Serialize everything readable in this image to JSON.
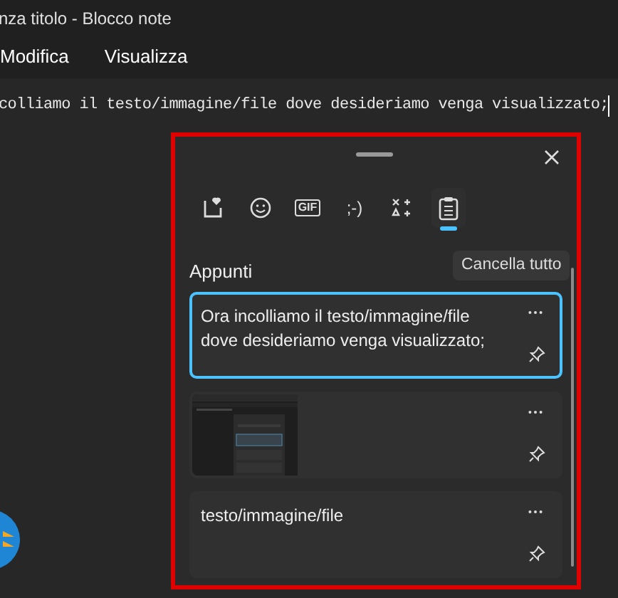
{
  "window": {
    "title": "nza titolo - Blocco note"
  },
  "menu": [
    "Modifica",
    "Visualizza"
  ],
  "editor": {
    "text": "colliamo il testo/immagine/file dove desideriamo venga visualizzato;"
  },
  "clipboard_panel": {
    "tabs": [
      {
        "kind": "favorites",
        "selected": false
      },
      {
        "kind": "emoji",
        "selected": false
      },
      {
        "kind": "gif",
        "label": "GIF",
        "selected": false
      },
      {
        "kind": "kaomoji",
        "label": ";-)",
        "selected": false
      },
      {
        "kind": "symbols",
        "selected": false
      },
      {
        "kind": "clipboard",
        "selected": true
      }
    ],
    "heading": "Appunti",
    "clear_button": "Cancella tutto",
    "items": [
      {
        "kind": "text",
        "text": "Ora incolliamo il testo/immagine/file dove desideriamo venga visualizzato;",
        "selected": true
      },
      {
        "kind": "picture",
        "selected": false
      },
      {
        "kind": "text",
        "text": "testo/immagine/file",
        "selected": false
      }
    ]
  }
}
